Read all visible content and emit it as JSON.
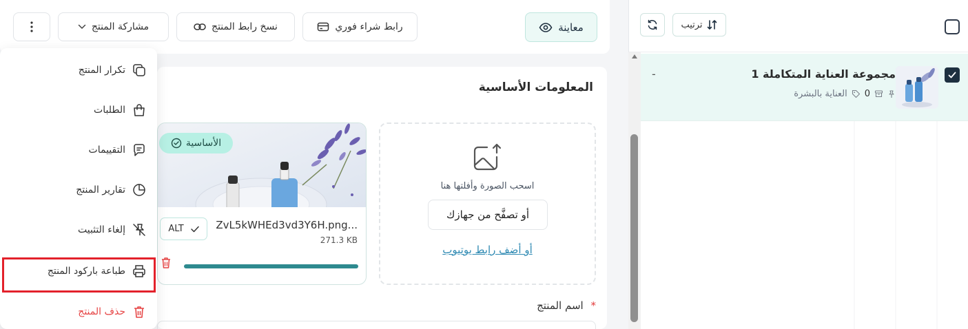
{
  "toolbar": {
    "more_label": "⋮",
    "share_label": "مشاركة المنتج",
    "copy_link_label": "نسخ رابط المنتج",
    "buy_link_label": "رابط شراء فوري",
    "preview_label": "معاينة"
  },
  "menu": {
    "items": [
      {
        "label": "تكرار المنتج",
        "icon": "copy-icon"
      },
      {
        "label": "الطلبات",
        "icon": "bag-icon"
      },
      {
        "label": "التقييمات",
        "icon": "comment-icon"
      },
      {
        "label": "تقارير المنتج",
        "icon": "pie-chart-icon"
      },
      {
        "label": "إلغاء التثبيت",
        "icon": "unpin-icon"
      },
      {
        "label": "طباعة باركود المنتج",
        "icon": "printer-icon"
      },
      {
        "label": "حذف المنتج",
        "icon": "trash-icon"
      }
    ]
  },
  "basic_info": {
    "title": "المعلومات الأساسية",
    "image": {
      "badge": "الأساسية",
      "file_name": "ZvL5kWHEd3vd3Y6H.png...",
      "file_size": "271.3 KB",
      "alt_label": "ALT",
      "upload_progress": 1.0
    },
    "upload": {
      "hint": "اسحب الصورة وأفلتها هنا",
      "browse_label": "أو تصفَّح من جهازك",
      "youtube_label": "أو أضف رابط يوتيوب"
    },
    "name_label": "اسم المنتج",
    "required_mark": "*"
  },
  "list": {
    "sort_label": "ترتيب",
    "products": [
      {
        "title": "مجموعة العناية المتكاملة 1",
        "category": "العناية بالبشرة",
        "count": "0",
        "price": "-",
        "selected": true
      }
    ]
  },
  "colors": {
    "accent": "#2e8a8f",
    "selected_row": "#eaf8f5",
    "badge": "#b7f0e4",
    "danger": "#e64545",
    "highlight": "#e3212b"
  }
}
